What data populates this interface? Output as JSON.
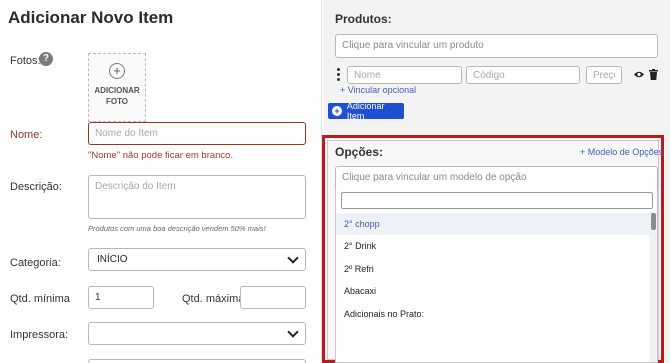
{
  "form": {
    "title": "Adicionar Novo Item",
    "photos_label": "Fotos:",
    "help_glyph": "?",
    "add_photo_plus": "+",
    "add_photo_line1": "ADICIONAR",
    "add_photo_line2": "FOTO",
    "name_label": "Nome:",
    "name_placeholder": "Nome do Item",
    "name_error": "\"Nome\" não pode ficar em branco.",
    "description_label": "Descrição:",
    "description_placeholder": "Descrição do Item",
    "description_hint": "Produtos com uma boa descrição vendem 50% mais!",
    "category_label": "Categoria:",
    "category_value": "INÍCIO",
    "qty_min_label": "Qtd. mínima",
    "qty_min_value": "1",
    "qty_max_label": "Qtd. máxima:",
    "qty_max_value": "",
    "printer_label": "Impressora:",
    "printer_value": ""
  },
  "products": {
    "title": "Produtos:",
    "link_placeholder": "Clique para vincular um produto",
    "name_placeholder": "Nome",
    "code_placeholder": "Código",
    "price_placeholder": "Preço",
    "link_optional": "+ Vincular opcional",
    "add_item_button": "Adicionar Item"
  },
  "options": {
    "title": "Opções:",
    "model_link": "+ Modelo de Opções",
    "select_placeholder": "Clique para vincular um modelo de opção",
    "search_value": "",
    "items": [
      {
        "label": "2° chopp",
        "highlighted": true
      },
      {
        "label": "2° Drink",
        "highlighted": false
      },
      {
        "label": "2º Refri",
        "highlighted": false
      },
      {
        "label": "Abacaxi",
        "highlighted": false
      },
      {
        "label": "Adicionais no Prato:",
        "highlighted": false
      }
    ]
  },
  "colors": {
    "accent_blue": "#1f4fd2",
    "error_red": "#a03a2a",
    "highlight_border": "#b51c1c"
  }
}
